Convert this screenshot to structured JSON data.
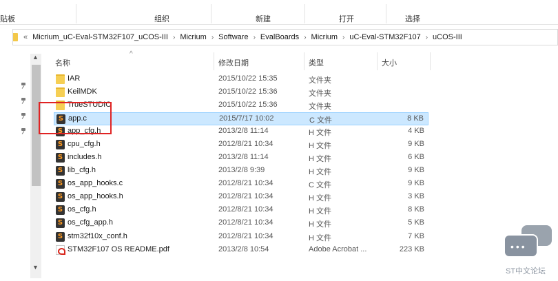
{
  "ribbon": {
    "clipboard": "贴板",
    "organize": "组织",
    "new": "新建",
    "open": "打开",
    "select": "选择"
  },
  "address": {
    "overflow": "«",
    "crumbs": [
      "Micrium_uC-Eval-STM32F107_uCOS-III",
      "Micrium",
      "Software",
      "EvalBoards",
      "Micrium",
      "uC-Eval-STM32F107",
      "uCOS-III"
    ],
    "separator": "›"
  },
  "scroll": {
    "up": "▲",
    "down": "▼"
  },
  "columns": {
    "name": "名称",
    "date": "修改日期",
    "type": "类型",
    "size": "大小",
    "sort_indicator": "^"
  },
  "files": [
    {
      "name": "IAR",
      "date": "2015/10/22 15:35",
      "type": "文件夹",
      "size": "",
      "icon": "folder-icon"
    },
    {
      "name": "KeilMDK",
      "date": "2015/10/22 15:36",
      "type": "文件夹",
      "size": "",
      "icon": "folder-icon"
    },
    {
      "name": "TrueSTUDIO",
      "date": "2015/10/22 15:36",
      "type": "文件夹",
      "size": "",
      "icon": "folder-icon"
    },
    {
      "name": "app.c",
      "date": "2015/7/17 10:02",
      "type": "C 文件",
      "size": "8 KB",
      "icon": "sublime-file-icon"
    },
    {
      "name": "app_cfg.h",
      "date": "2013/2/8 11:14",
      "type": "H 文件",
      "size": "4 KB",
      "icon": "sublime-file-icon"
    },
    {
      "name": "cpu_cfg.h",
      "date": "2012/8/21 10:34",
      "type": "H 文件",
      "size": "9 KB",
      "icon": "sublime-file-icon"
    },
    {
      "name": "includes.h",
      "date": "2013/2/8 11:14",
      "type": "H 文件",
      "size": "6 KB",
      "icon": "sublime-file-icon"
    },
    {
      "name": "lib_cfg.h",
      "date": "2013/2/8 9:39",
      "type": "H 文件",
      "size": "9 KB",
      "icon": "sublime-file-icon"
    },
    {
      "name": "os_app_hooks.c",
      "date": "2012/8/21 10:34",
      "type": "C 文件",
      "size": "9 KB",
      "icon": "sublime-file-icon"
    },
    {
      "name": "os_app_hooks.h",
      "date": "2012/8/21 10:34",
      "type": "H 文件",
      "size": "3 KB",
      "icon": "sublime-file-icon"
    },
    {
      "name": "os_cfg.h",
      "date": "2012/8/21 10:34",
      "type": "H 文件",
      "size": "8 KB",
      "icon": "sublime-file-icon"
    },
    {
      "name": "os_cfg_app.h",
      "date": "2012/8/21 10:34",
      "type": "H 文件",
      "size": "5 KB",
      "icon": "sublime-file-icon"
    },
    {
      "name": "stm32f10x_conf.h",
      "date": "2012/8/21 10:34",
      "type": "H 文件",
      "size": "7 KB",
      "icon": "sublime-file-icon"
    },
    {
      "name": "STM32F107 OS README.pdf",
      "date": "2013/2/8 10:54",
      "type": "Adobe Acrobat ...",
      "size": "223 KB",
      "icon": "pdf-icon"
    }
  ],
  "selected_file": "app.c",
  "colors": {
    "selection_bg": "#cce8ff",
    "selection_border": "#99d1ff",
    "annotation": "#e02323",
    "folder": "#f6cf54"
  },
  "watermark": {
    "text": "ST中文论坛",
    "dots": "•••"
  }
}
